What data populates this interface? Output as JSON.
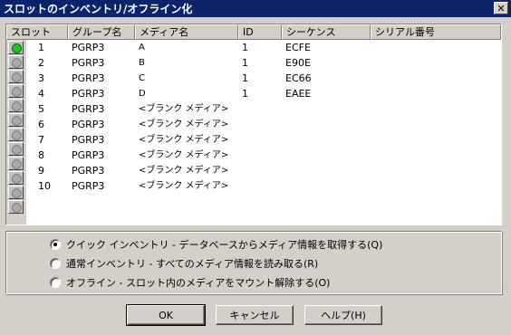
{
  "window": {
    "title": "スロットのインベントリ/オフライン化",
    "close_label": "✕"
  },
  "table": {
    "columns": [
      "スロット",
      "グループ名",
      "メディア名",
      "ID",
      "シーケンス",
      "シリアル番号"
    ],
    "rows": [
      {
        "slot": "1",
        "group": "PGRP3",
        "media": "A",
        "id": "1",
        "seq": "ECFE",
        "serial": "",
        "active": true
      },
      {
        "slot": "2",
        "group": "PGRP3",
        "media": "B",
        "id": "1",
        "seq": "E90E",
        "serial": ""
      },
      {
        "slot": "3",
        "group": "PGRP3",
        "media": "C",
        "id": "1",
        "seq": "EC66",
        "serial": ""
      },
      {
        "slot": "4",
        "group": "PGRP3",
        "media": "D",
        "id": "1",
        "seq": "EAEE",
        "serial": ""
      },
      {
        "slot": "5",
        "group": "PGRP3",
        "media": "<ブランク メディア>",
        "id": "",
        "seq": "",
        "serial": ""
      },
      {
        "slot": "6",
        "group": "PGRP3",
        "media": "<ブランク メディア>",
        "id": "",
        "seq": "",
        "serial": ""
      },
      {
        "slot": "7",
        "group": "PGRP3",
        "media": "<ブランク メディア>",
        "id": "",
        "seq": "",
        "serial": ""
      },
      {
        "slot": "8",
        "group": "PGRP3",
        "media": "<ブランク メディア>",
        "id": "",
        "seq": "",
        "serial": ""
      },
      {
        "slot": "9",
        "group": "PGRP3",
        "media": "<ブランク メディア>",
        "id": "",
        "seq": "",
        "serial": ""
      },
      {
        "slot": "10",
        "group": "PGRP3",
        "media": "<ブランク メディア>",
        "id": "",
        "seq": "",
        "serial": ""
      }
    ]
  },
  "options": [
    {
      "label": "クイック インベントリ - データベースからメディア情報を取得する(Q)",
      "checked": true
    },
    {
      "label": "通常インベントリ - すべてのメディア情報を読み取る(R)",
      "checked": false
    },
    {
      "label": "オフライン - スロット内のメディアをマウント解除する(O)",
      "checked": false
    }
  ],
  "buttons": {
    "ok": "OK",
    "cancel": "キャンセル",
    "help": "ヘルプ(H)"
  }
}
